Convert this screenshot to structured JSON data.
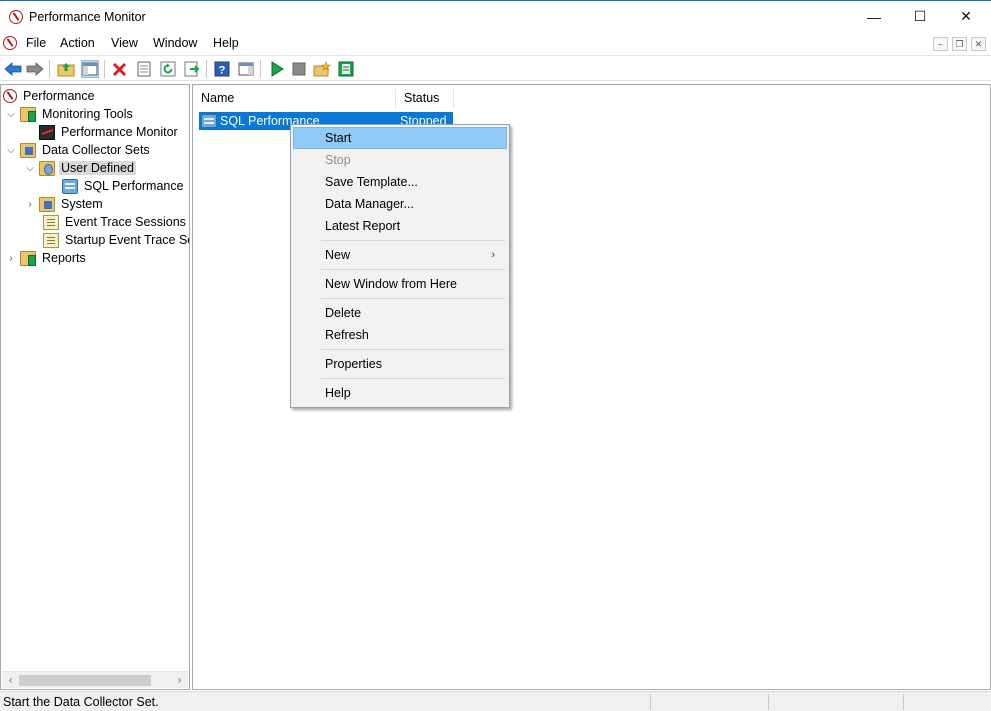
{
  "window": {
    "title": "Performance Monitor",
    "controls": {
      "minimize": "—",
      "maximize": "☐",
      "close": "✕"
    }
  },
  "menubar": {
    "items": [
      "File",
      "Action",
      "View",
      "Window",
      "Help"
    ],
    "mdi_controls": {
      "minimize": "–",
      "restore": "❐",
      "close": "✕"
    }
  },
  "tree": {
    "items": [
      {
        "label": "Performance",
        "icon": "performance-icon",
        "expanded": null
      },
      {
        "label": "Monitoring Tools",
        "icon": "folder-chart-icon",
        "expanded": true
      },
      {
        "label": "Performance Monitor",
        "icon": "monitor-icon",
        "expanded": null
      },
      {
        "label": "Data Collector Sets",
        "icon": "folder-data-icon",
        "expanded": true
      },
      {
        "label": "User Defined",
        "icon": "folder-user-icon",
        "expanded": true,
        "selected": true
      },
      {
        "label": "SQL Performance",
        "icon": "data-collector-set-icon",
        "expanded": null
      },
      {
        "label": "System",
        "icon": "folder-system-icon",
        "expanded": false
      },
      {
        "label": "Event Trace Sessions",
        "icon": "document-icon",
        "expanded": null
      },
      {
        "label": "Startup Event Trace Ses",
        "icon": "document-icon",
        "expanded": null
      },
      {
        "label": "Reports",
        "icon": "folder-reports-icon",
        "expanded": false
      }
    ]
  },
  "list": {
    "columns": [
      "Name",
      "Status"
    ],
    "rows": [
      {
        "name": "SQL Performance",
        "status": "Stopped"
      }
    ]
  },
  "context_menu": {
    "start": "Start",
    "stop": "Stop",
    "save_template": "Save Template...",
    "data_manager": "Data Manager...",
    "latest_report": "Latest Report",
    "new": "New",
    "new_window": "New Window from Here",
    "delete": "Delete",
    "refresh": "Refresh",
    "properties": "Properties",
    "help": "Help"
  },
  "statusbar": {
    "text": "Start the Data Collector Set."
  },
  "colors": {
    "selection": "#0a78d7",
    "menu_hover": "#91c9f7",
    "menu_bg": "#f2f2f2"
  }
}
